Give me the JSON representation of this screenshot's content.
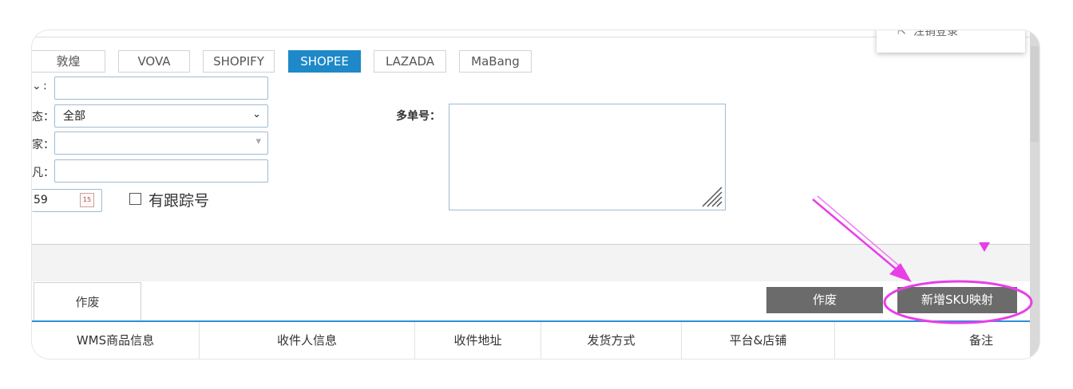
{
  "platform_tabs": [
    {
      "label": "敦煌",
      "active": false
    },
    {
      "label": "VOVA",
      "active": false
    },
    {
      "label": "SHOPIFY",
      "active": false
    },
    {
      "label": "SHOPEE",
      "active": true
    },
    {
      "label": "LAZADA",
      "active": false
    },
    {
      "label": "MaBang",
      "active": false
    }
  ],
  "account_menu": {
    "item_label": "注销登录"
  },
  "form": {
    "row1_label": ":",
    "row2_label": "态：",
    "row2_value": "全部",
    "row3_label": "家：",
    "row4_label": "凡：",
    "date_value": "59",
    "calendar_day": "15",
    "tracking_checkbox_label": "有跟踪号",
    "multi_order_label": "多单号："
  },
  "tabs": {
    "void_label": "作废"
  },
  "toolbar": {
    "void_button": "作废",
    "add_sku_mapping_button": "新增SKU映射"
  },
  "table": {
    "headers": [
      "WMS商品信息",
      "收件人信息",
      "收件地址",
      "发货方式",
      "平台&店铺",
      "备注"
    ]
  },
  "colors": {
    "accent": "#1e88c9",
    "annotation": "#e83ee8",
    "button": "#6b6b6b"
  }
}
